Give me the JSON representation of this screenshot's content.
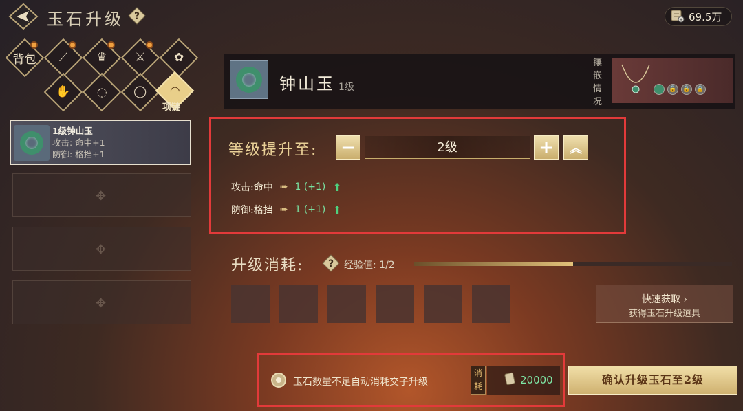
{
  "header": {
    "title": "玉石升级",
    "currency_amount": "69.5万"
  },
  "categories": {
    "bag_label": "背包",
    "necklace_label": "项链"
  },
  "left_list": {
    "selected_item": {
      "name": "1级钟山玉",
      "stat1": "攻击: 命中+1",
      "stat2": "防御: 格挡+1"
    }
  },
  "info": {
    "gem_name": "钟山玉",
    "gem_level": "1级",
    "inlay_label": "镶嵌情况"
  },
  "upgrade": {
    "label": "等级提升至:",
    "minus": "−",
    "plus": "+",
    "max": "︽",
    "target_level": "2级",
    "stats": [
      {
        "name": "攻击:命中",
        "value": "1 (+1)"
      },
      {
        "name": "防御:格挡",
        "value": "1 (+1)"
      }
    ]
  },
  "consume": {
    "label": "升级消耗:",
    "exp_label": "经验值:",
    "exp_value": "1/2",
    "exp_progress": 0.5,
    "quick_title": "快速获取",
    "quick_sub": "获得玉石升级道具"
  },
  "bottom": {
    "auto_text": "玉石数量不足自动消耗交子升级",
    "consume_tag": "消耗",
    "cost": "20000",
    "confirm_label": "确认升级玉石至2级"
  },
  "colors": {
    "highlight_border": "#e23a3a",
    "gain_green": "#79e0a0",
    "gold": "#e8cf96"
  }
}
